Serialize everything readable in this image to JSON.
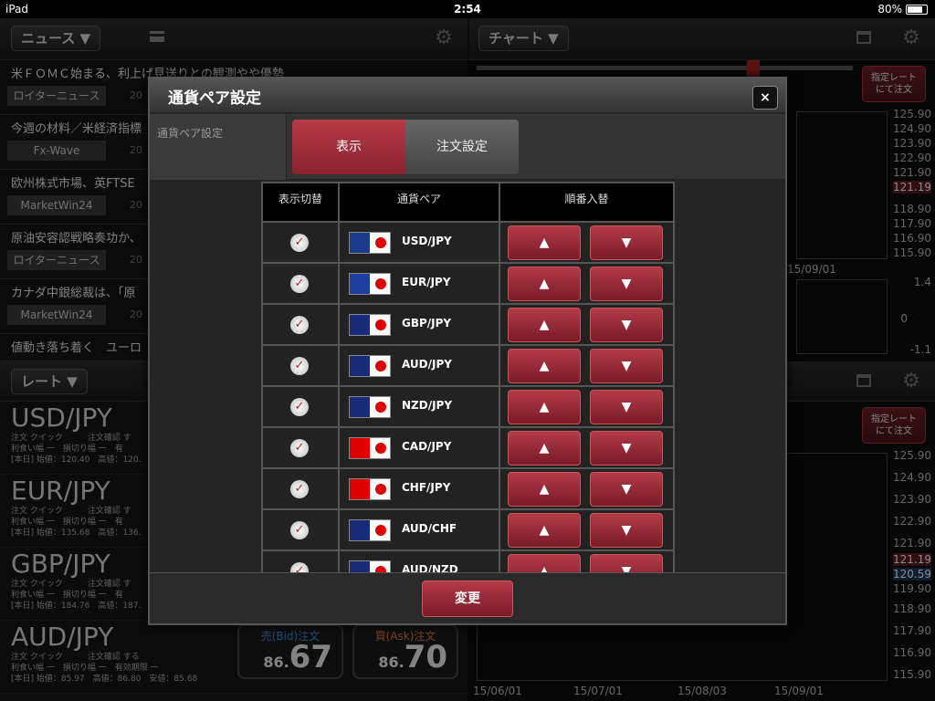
{
  "status": {
    "device": "iPad",
    "time": "2:54",
    "battery": "80%"
  },
  "news": {
    "menu_label": "ニュース ▼",
    "items": [
      {
        "title": "米ＦＯＭＣ始まる、利上げ見送りとの観測やや優勢",
        "source": "ロイターニュース",
        "date": "20"
      },
      {
        "title": "今週の材料／米経済指標",
        "source": "Fx-Wave",
        "date": "20"
      },
      {
        "title": "欧州株式市場、英FTSE",
        "source": "MarketWin24",
        "date": "20"
      },
      {
        "title": "原油安容認戦略奏功か、",
        "source": "ロイターニュース",
        "date": "20"
      },
      {
        "title": "カナダ中銀総裁は、「原",
        "source": "MarketWin24",
        "date": "20"
      },
      {
        "title": "値動き落ち着く　ユーロ",
        "source": "",
        "date": ""
      }
    ]
  },
  "rates": {
    "menu_label": "レート ▼",
    "items": [
      {
        "pair": "USD/JPY",
        "line1": "注文 クイック　　　注文確認 す",
        "line2": "利食い幅 一　損切り幅 一　有",
        "line3": "[本日] 始値：120.40　高値：120.",
        "bid": "",
        "ask": ""
      },
      {
        "pair": "EUR/JPY",
        "line1": "注文 クイック　　　注文確認 す",
        "line2": "利食い幅 一　損切り幅 一　有",
        "line3": "[本日] 始値：135.68　高値：136.",
        "bid": "",
        "ask": ""
      },
      {
        "pair": "GBP/JPY",
        "line1": "注文 クイック　　　注文確認 す",
        "line2": "利食い幅 一　損切り幅 一　有",
        "line3": "[本日] 始値：184.76　高値：187.",
        "bid": "",
        "ask": ""
      },
      {
        "pair": "AUD/JPY",
        "line1": "注文 クイック　　　注文確認 する",
        "line2": "利食い幅 一　損切り幅 一　有効期限 一",
        "line3": "[本日] 始値：85.97　高値：86.80　安値：85.68",
        "bid_label": "売(Bid)注文",
        "bid_small": "86.",
        "bid_big": "67",
        "ask_label": "買(Ask)注文",
        "ask_small": "86.",
        "ask_big": "70"
      }
    ]
  },
  "chart": {
    "menu_label": "チャート ▼",
    "order_btn": "指定レート\nにて注文",
    "y_top": [
      "125.90",
      "124.90",
      "123.90",
      "122.90",
      "121.90",
      "121.19",
      "118.90",
      "117.90",
      "116.90",
      "115.90"
    ],
    "x_date": "15/09/01",
    "osc": [
      "1.4",
      "0",
      "-1.1"
    ],
    "y_bottom": [
      "125.90",
      "124.90",
      "123.90",
      "122.90",
      "121.90",
      "121.19",
      "120.59",
      "119.90",
      "118.90",
      "117.90",
      "116.90",
      "115.90"
    ],
    "x_bottom": [
      "15/06/01",
      "15/07/01",
      "15/08/03",
      "15/09/01"
    ]
  },
  "dialog": {
    "title": "通貨ペア設定",
    "close": "×",
    "section_label": "通貨ペア設定",
    "tab_display": "表示",
    "tab_order": "注文設定",
    "col_toggle": "表示切替",
    "col_pair": "通貨ペア",
    "col_order": "順番入替",
    "rows": [
      {
        "pair": "USD/JPY",
        "c1": "#1a3a8a",
        "c2": "#c00"
      },
      {
        "pair": "EUR/JPY",
        "c1": "#1f3fa0",
        "c2": "#c00"
      },
      {
        "pair": "GBP/JPY",
        "c1": "#1a2a7a",
        "c2": "#c00"
      },
      {
        "pair": "AUD/JPY",
        "c1": "#1a2a7a",
        "c2": "#c00"
      },
      {
        "pair": "NZD/JPY",
        "c1": "#1a2a7a",
        "c2": "#c00"
      },
      {
        "pair": "CAD/JPY",
        "c1": "#d00",
        "c2": "#c00"
      },
      {
        "pair": "CHF/JPY",
        "c1": "#d00",
        "c2": "#c00"
      },
      {
        "pair": "AUD/CHF",
        "c1": "#1a2a7a",
        "c2": "#d00"
      },
      {
        "pair": "AUD/NZD",
        "c1": "#1a2a7a",
        "c2": "#1a2a7a"
      }
    ],
    "up_glyph": "▲",
    "down_glyph": "▼",
    "check_glyph": "✓",
    "submit": "変更"
  }
}
